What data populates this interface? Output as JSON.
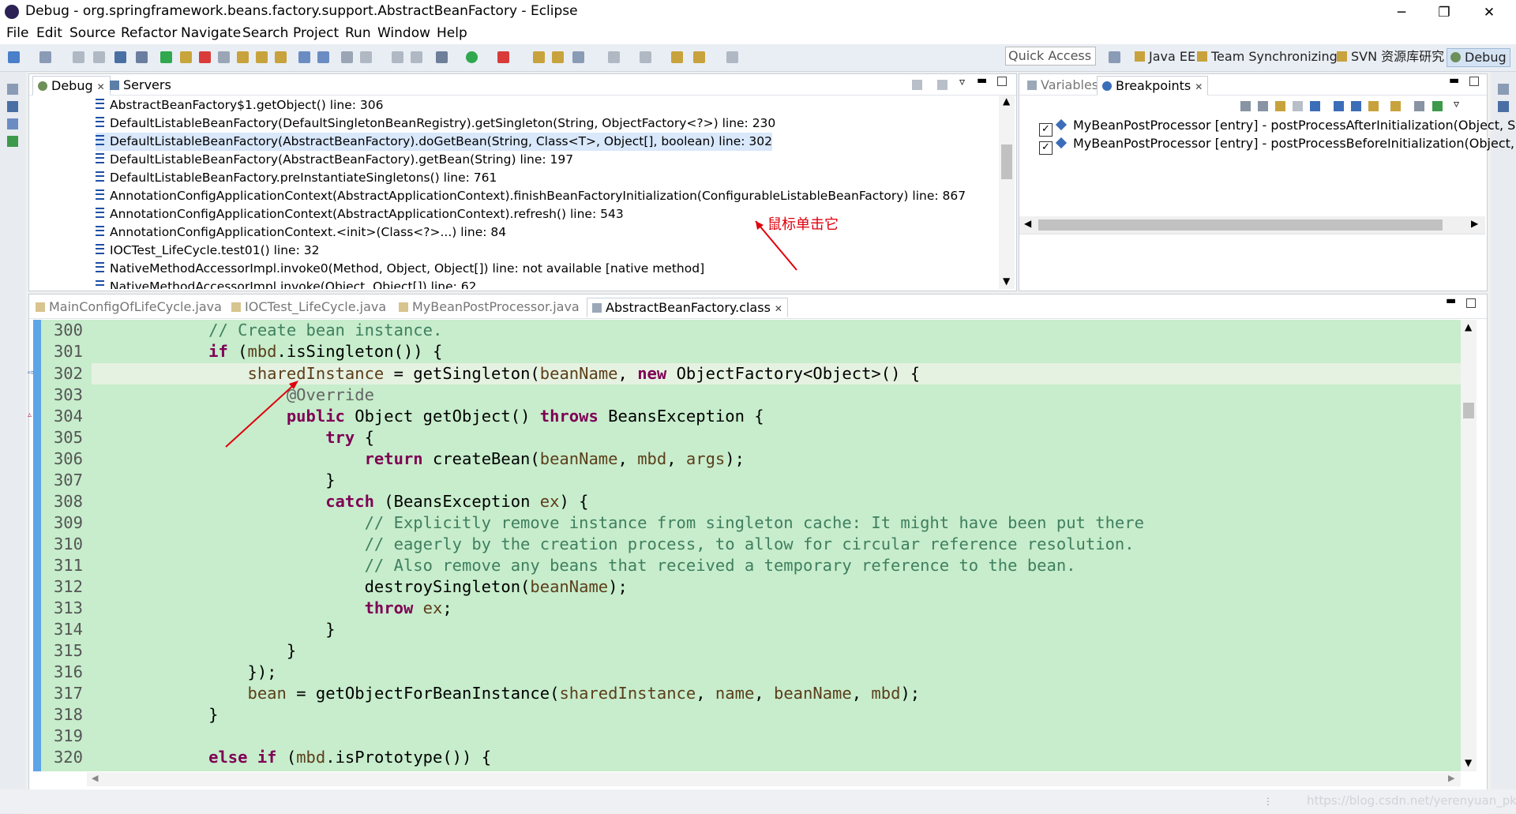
{
  "window": {
    "title": "Debug - org.springframework.beans.factory.support.AbstractBeanFactory - Eclipse",
    "controls": {
      "minimize": "─",
      "maximize": "❐",
      "close": "✕"
    }
  },
  "menu": [
    "File",
    "Edit",
    "Source",
    "Refactor",
    "Navigate",
    "Search",
    "Project",
    "Run",
    "Window",
    "Help"
  ],
  "toolbar": {
    "quick_access": "Quick Access",
    "perspectives": [
      "Java EE",
      "Team Synchronizing",
      "SVN 资源库研究",
      "Debug"
    ]
  },
  "debug_view": {
    "tabs": [
      "Debug",
      "Servers"
    ],
    "stack_frames": [
      "AbstractBeanFactory$1.getObject() line: 306",
      "DefaultListableBeanFactory(DefaultSingletonBeanRegistry).getSingleton(String, ObjectFactory<?>) line: 230",
      "DefaultListableBeanFactory(AbstractBeanFactory).doGetBean(String, Class<T>, Object[], boolean) line: 302",
      "DefaultListableBeanFactory(AbstractBeanFactory).getBean(String) line: 197",
      "DefaultListableBeanFactory.preInstantiateSingletons() line: 761",
      "AnnotationConfigApplicationContext(AbstractApplicationContext).finishBeanFactoryInitialization(ConfigurableListableBeanFactory) line: 867",
      "AnnotationConfigApplicationContext(AbstractApplicationContext).refresh() line: 543",
      "AnnotationConfigApplicationContext.<init>(Class<?>...) line: 84",
      "IOCTest_LifeCycle.test01() line: 32",
      "NativeMethodAccessorImpl.invoke0(Method, Object, Object[]) line: not available [native method]",
      "NativeMethodAccessorImpl.invoke(Object, Object[]) line: 62"
    ],
    "selected_index": 2,
    "annotation": "鼠标单击它"
  },
  "breakpoints_view": {
    "tabs": [
      "Variables",
      "Breakpoints"
    ],
    "items": [
      "MyBeanPostProcessor [entry] - postProcessAfterInitialization(Object, Str",
      "MyBeanPostProcessor [entry] - postProcessBeforeInitialization(Object, S"
    ]
  },
  "editor": {
    "tabs": [
      "MainConfigOfLifeCycle.java",
      "IOCTest_LifeCycle.java",
      "MyBeanPostProcessor.java",
      "AbstractBeanFactory.class"
    ],
    "active_tab": 3,
    "line_numbers": [
      "300",
      "301",
      "302",
      "303",
      "304",
      "305",
      "306",
      "307",
      "308",
      "309",
      "310",
      "311",
      "312",
      "313",
      "314",
      "315",
      "316",
      "317",
      "318",
      "319",
      "320"
    ]
  },
  "watermark": "https://blog.csdn.net/yerenyuan_pku",
  "colors": {
    "editor_bg": "#c7edcc",
    "keyword": "#7f0055",
    "comment": "#3f7f5f",
    "selection": "#d9e8fb",
    "annotation": "#e0000b"
  }
}
